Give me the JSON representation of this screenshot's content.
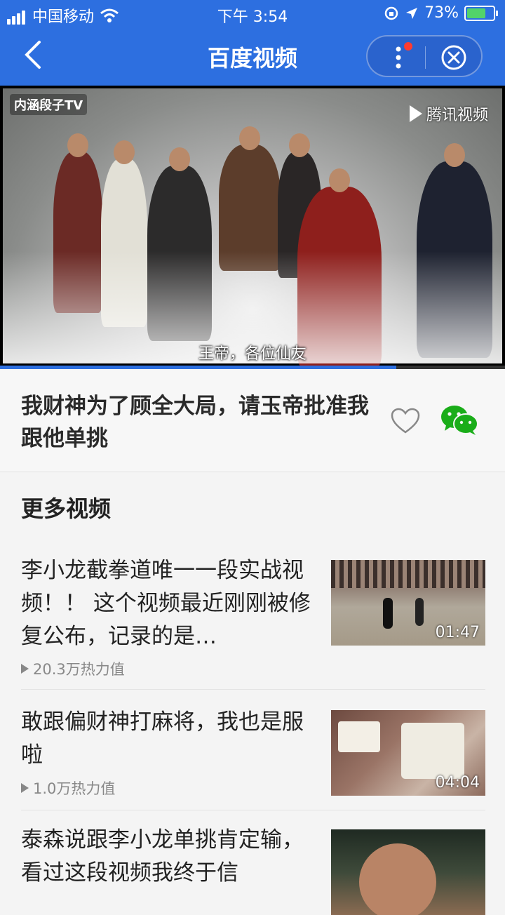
{
  "status": {
    "carrier": "中国移动",
    "time": "下午 3:54",
    "battery": "73%"
  },
  "nav": {
    "title": "百度视频"
  },
  "video": {
    "watermark_left": "内涵段子TV",
    "watermark_right": "腾讯视频",
    "subtitle": "王帝，各位仙友",
    "progress": 0.785
  },
  "current": {
    "title": "我财神为了顾全大局，请玉帝批准我跟他单挑"
  },
  "more": {
    "heading": "更多视频",
    "items": [
      {
        "title": "李小龙截拳道唯一一段实战视频！！ 这个视频最近刚刚被修复公布，记录的是…",
        "views": "20.3万热力值",
        "duration": "01:47"
      },
      {
        "title": "敢跟偏财神打麻将，我也是服啦",
        "views": "1.0万热力值",
        "duration": "04:04"
      },
      {
        "title": "泰森说跟李小龙单挑肯定输，看过这段视频我终于信",
        "views": "",
        "duration": ""
      }
    ]
  },
  "colors": {
    "accent": "#2d6fe0",
    "wechat": "#1aad19"
  }
}
